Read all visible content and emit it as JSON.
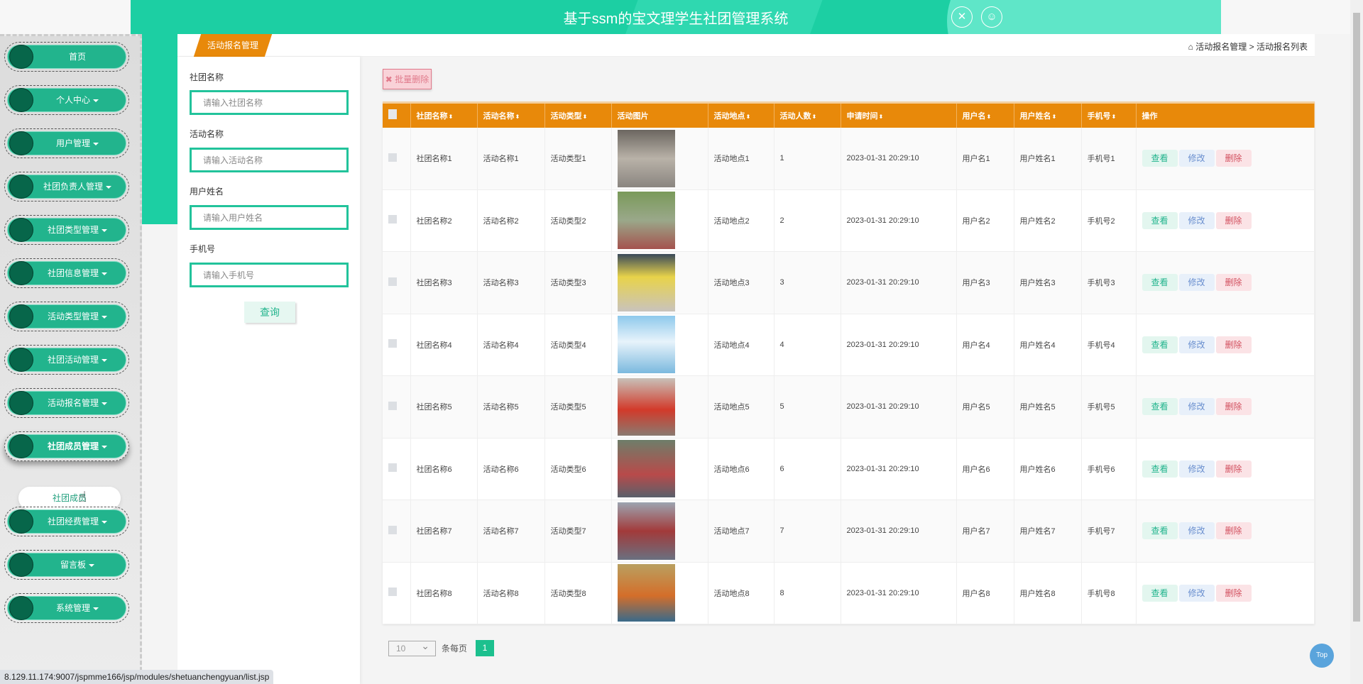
{
  "header": {
    "title": "基于ssm的宝文理学生社团管理系统",
    "icons": [
      "fullscreen-icon",
      "user-icon"
    ]
  },
  "sidebar": {
    "items": [
      {
        "label": "首页",
        "caret": false
      },
      {
        "label": "个人中心",
        "caret": true
      },
      {
        "label": "用户管理",
        "caret": true
      },
      {
        "label": "社团负责人管理",
        "caret": true
      },
      {
        "label": "社团类型管理",
        "caret": true
      },
      {
        "label": "社团信息管理",
        "caret": true
      },
      {
        "label": "活动类型管理",
        "caret": true
      },
      {
        "label": "社团活动管理",
        "caret": true
      },
      {
        "label": "活动报名管理",
        "caret": true
      },
      {
        "label": "社团成员管理",
        "caret": true,
        "active": true
      },
      {
        "label": "社团经费管理",
        "caret": true
      },
      {
        "label": "留言板",
        "caret": true
      },
      {
        "label": "系统管理",
        "caret": true
      }
    ],
    "subitem": "社团成员"
  },
  "breadcrumb": {
    "tab": "活动报名管理",
    "path1": "活动报名管理",
    "sep": ">",
    "path2": "活动报名列表"
  },
  "search": {
    "fields": [
      {
        "label": "社团名称",
        "placeholder": "请输入社团名称"
      },
      {
        "label": "活动名称",
        "placeholder": "请输入活动名称"
      },
      {
        "label": "用户姓名",
        "placeholder": "请输入用户姓名"
      },
      {
        "label": "手机号",
        "placeholder": "请输入手机号"
      }
    ],
    "button": "查询"
  },
  "toolbar": {
    "batch_delete": "批量删除"
  },
  "table": {
    "columns": [
      "社团名称",
      "活动名称",
      "活动类型",
      "活动图片",
      "活动地点",
      "活动人数",
      "申请时间",
      "用户名",
      "用户姓名",
      "手机号",
      "操作"
    ],
    "sortable": [
      true,
      true,
      true,
      false,
      true,
      true,
      true,
      true,
      true,
      true,
      false
    ],
    "actions": {
      "view": "查看",
      "edit": "修改",
      "delete": "删除"
    },
    "rows": [
      [
        "社团名称1",
        "活动名称1",
        "活动类型1",
        "",
        "活动地点1",
        "1",
        "2023-01-31 20:29:10",
        "用户名1",
        "用户姓名1",
        "手机号1"
      ],
      [
        "社团名称2",
        "活动名称2",
        "活动类型2",
        "",
        "活动地点2",
        "2",
        "2023-01-31 20:29:10",
        "用户名2",
        "用户姓名2",
        "手机号2"
      ],
      [
        "社团名称3",
        "活动名称3",
        "活动类型3",
        "",
        "活动地点3",
        "3",
        "2023-01-31 20:29:10",
        "用户名3",
        "用户姓名3",
        "手机号3"
      ],
      [
        "社团名称4",
        "活动名称4",
        "活动类型4",
        "",
        "活动地点4",
        "4",
        "2023-01-31 20:29:10",
        "用户名4",
        "用户姓名4",
        "手机号4"
      ],
      [
        "社团名称5",
        "活动名称5",
        "活动类型5",
        "",
        "活动地点5",
        "5",
        "2023-01-31 20:29:10",
        "用户名5",
        "用户姓名5",
        "手机号5"
      ],
      [
        "社团名称6",
        "活动名称6",
        "活动类型6",
        "",
        "活动地点6",
        "6",
        "2023-01-31 20:29:10",
        "用户名6",
        "用户姓名6",
        "手机号6"
      ],
      [
        "社团名称7",
        "活动名称7",
        "活动类型7",
        "",
        "活动地点7",
        "7",
        "2023-01-31 20:29:10",
        "用户名7",
        "用户姓名7",
        "手机号7"
      ],
      [
        "社团名称8",
        "活动名称8",
        "活动类型8",
        "",
        "活动地点8",
        "8",
        "2023-01-31 20:29:10",
        "用户名8",
        "用户姓名8",
        "手机号8"
      ]
    ]
  },
  "pagination": {
    "page_size": "10",
    "per_page_label": "条每页",
    "current_page": "1"
  },
  "top_button": "Top",
  "status_url": "8.129.11.174:9007/jspmme166/jsp/modules/shetuanchengyuan/list.jsp",
  "colors": {
    "header": "#1ccfa3",
    "table_header": "#e8890a",
    "nav": "#22b48d",
    "page_active": "#1cc08e"
  }
}
